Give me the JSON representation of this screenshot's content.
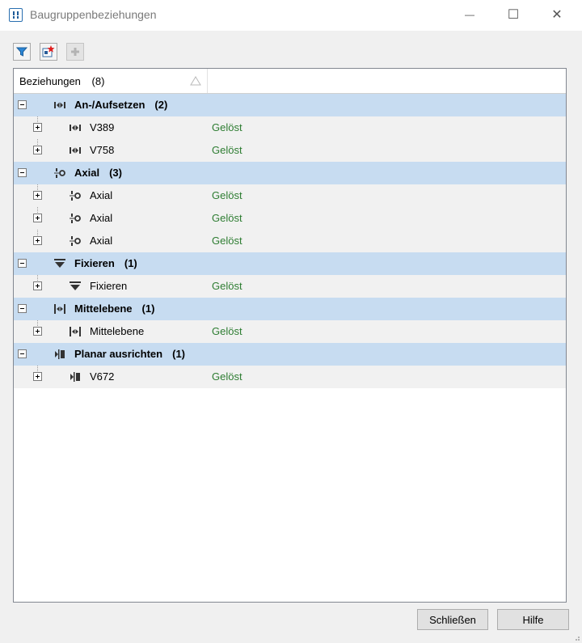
{
  "window": {
    "title": "Baugruppenbeziehungen",
    "minimize": "—",
    "maximize": "☐",
    "close": "✕"
  },
  "toolbar": {
    "buttons": [
      {
        "name": "filter-button",
        "icon": "filter-icon"
      },
      {
        "name": "highlight-button",
        "icon": "highlight-icon"
      },
      {
        "name": "add-button",
        "icon": "plus-icon",
        "disabled": true
      }
    ]
  },
  "table": {
    "column_header": "Beziehungen",
    "column_count": "(8)",
    "groups": [
      {
        "label": "An-/Aufsetzen",
        "count": "(2)",
        "icon": "an-aufsetzen-icon",
        "children": [
          {
            "label": "V389",
            "status": "Gelöst"
          },
          {
            "label": "V758",
            "status": "Gelöst"
          }
        ]
      },
      {
        "label": "Axial",
        "count": "(3)",
        "icon": "axial-icon",
        "children": [
          {
            "label": "Axial",
            "status": "Gelöst"
          },
          {
            "label": "Axial",
            "status": "Gelöst"
          },
          {
            "label": "Axial",
            "status": "Gelöst"
          }
        ]
      },
      {
        "label": "Fixieren",
        "count": "(1)",
        "icon": "fixieren-icon",
        "children": [
          {
            "label": "Fixieren",
            "status": "Gelöst"
          }
        ]
      },
      {
        "label": "Mittelebene",
        "count": "(1)",
        "icon": "mittelebene-icon",
        "children": [
          {
            "label": "Mittelebene",
            "status": "Gelöst"
          }
        ]
      },
      {
        "label": "Planar ausrichten",
        "count": "(1)",
        "icon": "planar-ausrichten-icon",
        "children": [
          {
            "label": "V672",
            "status": "Gelöst"
          }
        ]
      }
    ]
  },
  "footer": {
    "close_label": "Schließen",
    "help_label": "Hilfe"
  },
  "colors": {
    "group_row": "#c7dcf1",
    "status_text": "#2e7d32",
    "accent": "#1e73be"
  }
}
